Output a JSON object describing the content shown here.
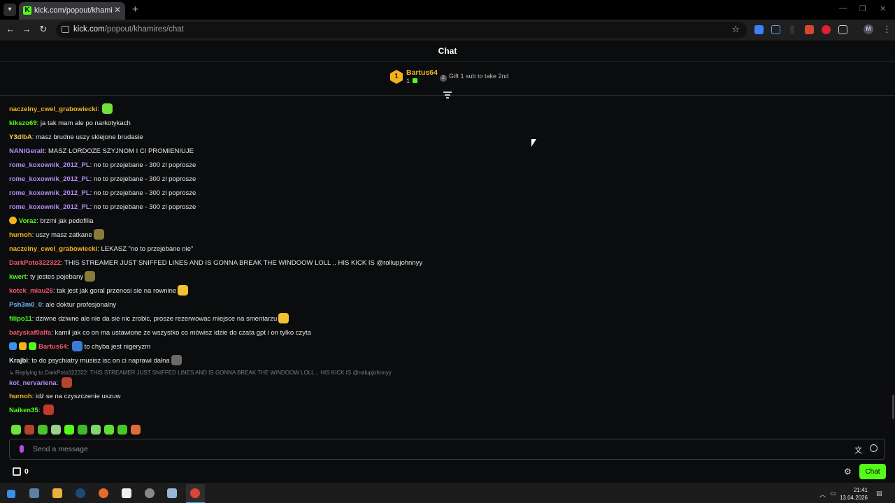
{
  "browser": {
    "tab_title": "kick.com/popout/khamires/chat",
    "tab_favicon": "K",
    "new_tab": "+",
    "url_host": "kick.com",
    "url_path": "/popout/khamires/chat",
    "profile_initial": "M"
  },
  "chat": {
    "title": "Chat",
    "leaderboard": {
      "rank": "1",
      "name": "Bartus64",
      "count": "1",
      "gift_hint": "Gift 1 sub to take 2nd",
      "gift_hint_icon": "2"
    },
    "messages": [
      {
        "user": "naczelny_cwel_grabowiecki",
        "color": "#f2b31e",
        "text": "",
        "emote": "#6fe13a"
      },
      {
        "user": "kikszo69",
        "color": "#53fc18",
        "text": "ja tak mam ale po narkotykach"
      },
      {
        "user": "Y3dlbA",
        "color": "#f2d04b",
        "text": "masz brudne uszy sklejone brudasie"
      },
      {
        "user": "NANIGeralt",
        "color": "#b48cf5",
        "text": "MASZ LORDOZE SZYJNOM I CI PROMIENIUJE"
      },
      {
        "user": "rome_koxownik_2012_PL",
        "color": "#b48cf5",
        "text": "no to przejebane - 300 zl poprosze"
      },
      {
        "user": "rome_koxownik_2012_PL",
        "color": "#b48cf5",
        "text": "no to przejebane - 300 zl poprosze"
      },
      {
        "user": "rome_koxownik_2012_PL",
        "color": "#b48cf5",
        "text": "no to przejebane - 300 zl poprosze"
      },
      {
        "user": "rome_koxownik_2012_PL",
        "color": "#b48cf5",
        "text": "no to przejebane - 300 zl poprosze"
      },
      {
        "user": "Voraz",
        "color": "#53fc18",
        "text": "brzmi jak pedofilia",
        "badge": "1"
      },
      {
        "user": "hurnoh",
        "color": "#f2b31e",
        "text": "uszy masz zatkane",
        "emote": "#8a7a3a"
      },
      {
        "user": "naczelny_cwel_grabowiecki",
        "color": "#f2b31e",
        "text": "LEKASZ \"no to przejebane nie\""
      },
      {
        "user": "DarkPoto322322",
        "color": "#f0566b",
        "text": "THIS STREAMER JUST SNIFFED LINES AND IS GONNA BREAK THE WINDOOW LOLL .. HIS KICK IS @rollupjohnnyy"
      },
      {
        "user": "kwert",
        "color": "#53fc18",
        "text": "ty jestes pojebany",
        "emote": "#8a7a3a"
      },
      {
        "user": "kotek_miau26",
        "color": "#f0566b",
        "text": "tak jest jak goral przenosi sie na rownine",
        "emote": "#f2c230"
      },
      {
        "user": "Psh3m0_0",
        "color": "#6ab0f5",
        "text": "ale doktur profesjonalny"
      },
      {
        "user": "filipo11",
        "color": "#53fc18",
        "text": "dziwne dziwne ale nie da sie nic zrobic, prosze rezerwowac miejsce na smentarzu",
        "emote": "#f2c230"
      },
      {
        "user": "batyskaf0alfa",
        "color": "#f0566b",
        "text": "kamil jak co on ma ustawione że wszystko co mówisz idzie do czata gpt i on tylko czyta"
      },
      {
        "user": "Bartus64",
        "color": "#f0566b",
        "text": "to chyba jest nigeryzm",
        "emote": "#3a7bd5",
        "badges": true
      },
      {
        "user": "Krajbi",
        "color": "#e6e6e6",
        "text": "to do psychiatry musisz isc on ci naprawi dałna",
        "emote": "#6a6a6a"
      },
      {
        "user": "kot_nervariena",
        "color": "#b48cf5",
        "text": "",
        "emote": "#b5442e"
      },
      {
        "user": "hurnoh",
        "color": "#f2b31e",
        "text": "idź se na czyszczenie uszuw"
      },
      {
        "user": "Naiken35",
        "color": "#53fc18",
        "text": "",
        "emote": "#c0392b"
      }
    ],
    "reply_notice": "Replying to DarkPoto322322: THIS STREAMER JUST SNIFFED LINES AND IS GONNA BREAK THE WINDOOW LOLL .. HIS KICK IS @rollupjohnnyy",
    "input_placeholder": "Send a message",
    "gift_count": "0",
    "send_button": "Chat"
  },
  "taskbar": {
    "time": "21:41",
    "date": "13.04.2026"
  }
}
